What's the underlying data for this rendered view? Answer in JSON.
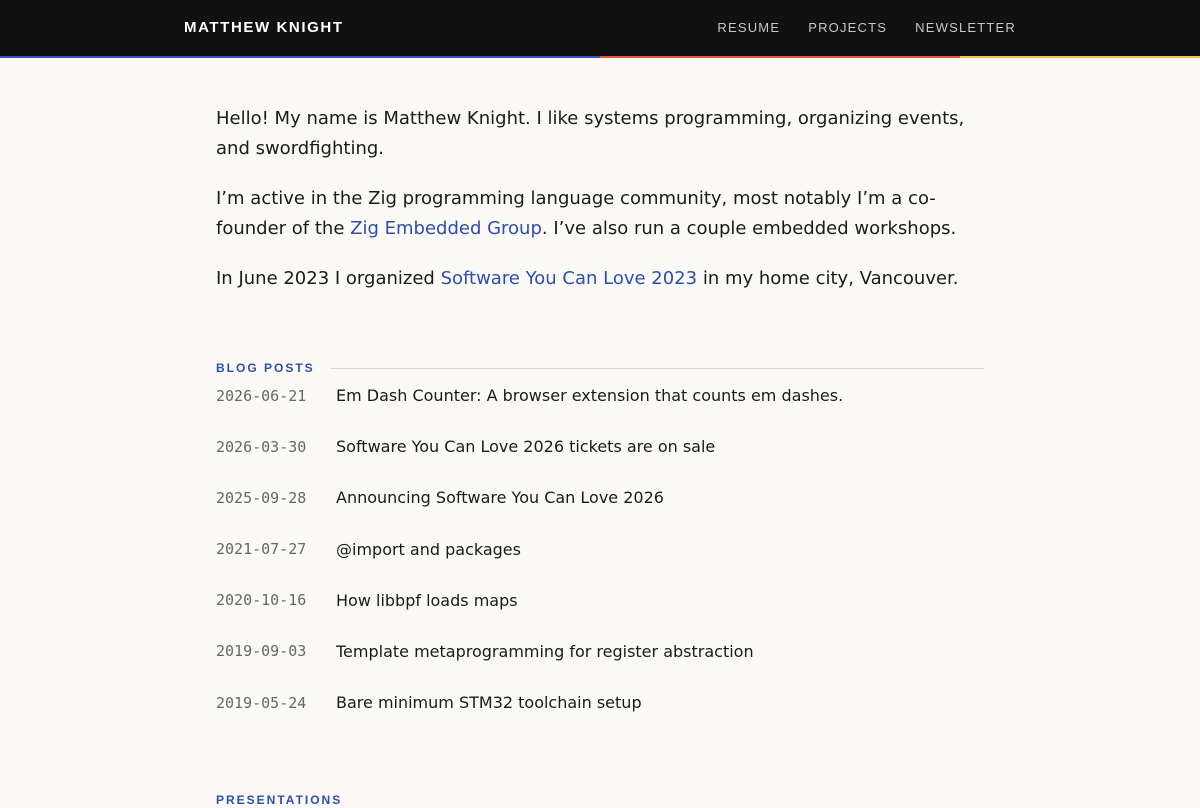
{
  "header": {
    "brand": "MATTHEW KNIGHT",
    "nav": [
      {
        "label": "RESUME"
      },
      {
        "label": "PROJECTS"
      },
      {
        "label": "NEWSLETTER"
      }
    ]
  },
  "colors": {
    "header_bg": "#111111",
    "page_bg": "#faf9f6",
    "link": "#2f4ea8",
    "stripe_blue": "#3653b8",
    "stripe_red": "#e2573d",
    "stripe_yellow": "#f4c34a"
  },
  "intro": {
    "p1": "Hello! My name is Matthew Knight. I like systems programming, organizing events, and swordfighting.",
    "p2_before": "I’m active in the Zig programming language community, most notably I’m a co-founder of the ",
    "p2_link": "Zig Embedded Group",
    "p2_after": ". I’ve also run a couple embedded workshops.",
    "p3_before": "In June 2023 I organized ",
    "p3_link": "Software You Can Love 2023",
    "p3_after": " in my home city, Vancouver."
  },
  "blog": {
    "title": "BLOG POSTS",
    "posts": [
      {
        "date": "2026-06-21",
        "title": "Em Dash Counter: A browser extension that counts em dashes."
      },
      {
        "date": "2026-03-30",
        "title": "Software You Can Love 2026 tickets are on sale"
      },
      {
        "date": "2025-09-28",
        "title": "Announcing Software You Can Love 2026"
      },
      {
        "date": "2021-07-27",
        "title": "@import and packages"
      },
      {
        "date": "2020-10-16",
        "title": "How libbpf loads maps"
      },
      {
        "date": "2019-09-03",
        "title": "Template metaprogramming for register abstraction"
      },
      {
        "date": "2019-05-24",
        "title": "Bare minimum STM32 toolchain setup"
      }
    ]
  },
  "presentations": {
    "title": "PRESENTATIONS"
  }
}
